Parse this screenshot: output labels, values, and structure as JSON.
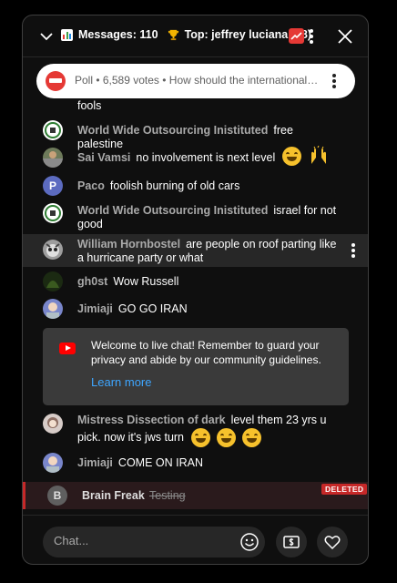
{
  "header": {
    "messages_label": "Messages: 110",
    "top_label": "Top: jeffrey luciana (18)"
  },
  "poll": {
    "text": "Poll • 6,589 votes • How should the international co..."
  },
  "messages": [
    {
      "author": "",
      "text": "fools"
    },
    {
      "author": "World Wide Outsourcing Inistituted",
      "text": "free palestine"
    },
    {
      "author": "Sai Vamsi",
      "text": "no involvement is next level"
    },
    {
      "author": "Paco",
      "text": "foolish burning of old cars",
      "avatar_letter": "P"
    },
    {
      "author": "World Wide Outsourcing Inistituted",
      "text": "israel for not good"
    },
    {
      "author": "William Hornbostel",
      "text": "are people on roof parting like a hurricane party or what"
    },
    {
      "author": "gh0st",
      "text": "Wow Russell"
    },
    {
      "author": "Jimiaji",
      "text": "GO GO IRAN"
    },
    {
      "author": "Mistress Dissection of dark",
      "text": "level them 23 yrs u pick. now it's jws turn"
    },
    {
      "author": "Jimiaji",
      "text": "COME ON IRAN"
    }
  ],
  "welcome": {
    "text": "Welcome to live chat! Remember to guard your privacy and abide by our community guidelines.",
    "link": "Learn more"
  },
  "deleted": {
    "avatar_letter": "B",
    "author": "Brain Freak",
    "text": "Testing",
    "tag": "DELETED"
  },
  "footer": {
    "placeholder": "Chat..."
  },
  "colors": {
    "background": "#0f0f0f",
    "author": "#aaaaaa",
    "link": "#3ea6ff",
    "deleted_tag": "#c62828"
  }
}
